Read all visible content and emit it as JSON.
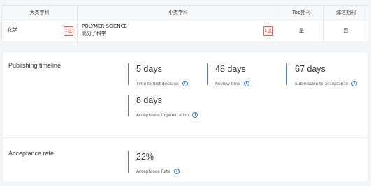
{
  "table": {
    "headers": [
      "大类学科",
      "小类学科",
      "Top期刊",
      "综述期刊"
    ],
    "row": {
      "major": "化学",
      "major_zone": "1区",
      "minor_en": "POLYMER SCIENCE",
      "minor_cn": "高分子科学",
      "minor_zone": "1区",
      "top": "是",
      "review": "否"
    }
  },
  "timeline": {
    "title": "Publishing timeline",
    "metrics": [
      {
        "value": "5 days",
        "label": "Time to first decision"
      },
      {
        "value": "48 days",
        "label": "Review time"
      },
      {
        "value": "67 days",
        "label": "Submission to acceptance"
      },
      {
        "value": "8 days",
        "label": "Acceptance to publication"
      }
    ]
  },
  "acceptance": {
    "title": "Acceptance rate",
    "value": "22%",
    "label": "Acceptance Rate"
  },
  "colors": {
    "accent_bar": "#5b7fa8",
    "info_icon": "#3a78c9",
    "zone_badge": "#e06464"
  },
  "icons": {
    "info": "info-circle-icon"
  }
}
